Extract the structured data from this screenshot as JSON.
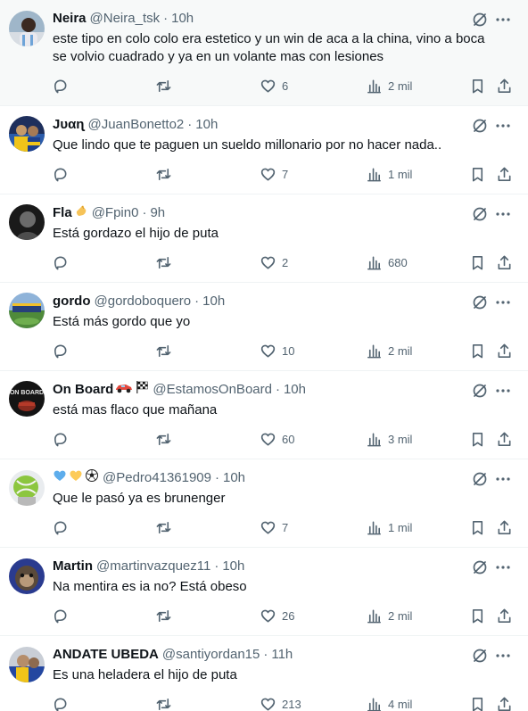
{
  "colors": {
    "text": "#0f1419",
    "secondary": "#536471",
    "border": "#eff3f4",
    "highlight": "#f7f9f9"
  },
  "tweets": [
    {
      "name": "Neira",
      "handle": "@Neira_tsk",
      "sep": "·",
      "time": "10h",
      "text": "este tipo en colo colo era estetico y un win de aca a la china, vino a boca se volvio cuadrado y ya en un volante mas con lesiones",
      "likes": "6",
      "views": "2 mil",
      "avatar": "neira",
      "badges": []
    },
    {
      "name": "Jυαɳ",
      "handle": "@JuanBonetto2",
      "sep": "·",
      "time": "10h",
      "text": "Que lindo que te paguen un sueldo millonario por no hacer nada..",
      "likes": "7",
      "views": "1 mil",
      "avatar": "juan",
      "badges": []
    },
    {
      "name": "Fla",
      "handle": "@Fpin0",
      "sep": "·",
      "time": "9h",
      "text": "Está gordazo el hijo de puta",
      "likes": "2",
      "views": "680",
      "avatar": "fla",
      "badges": [
        "fingers-crossed-emoji"
      ]
    },
    {
      "name": "gordo",
      "handle": "@gordoboquero",
      "sep": "·",
      "time": "10h",
      "text": "Está más gordo que yo",
      "likes": "10",
      "views": "2 mil",
      "avatar": "gordo",
      "badges": []
    },
    {
      "name": "On Board",
      "handle": "@EstamosOnBoard",
      "sep": "·",
      "time": "10h",
      "text": "está mas flaco que mañana",
      "likes": "60",
      "views": "3 mil",
      "avatar": "onboard",
      "avatar_text": "ON BOARD",
      "badges": [
        "race-car-emoji",
        "checkered-flag-emoji"
      ]
    },
    {
      "name": "",
      "handle": "@Pedro41361909",
      "sep": "·",
      "time": "10h",
      "text": "Que le pasó ya es brunenger",
      "likes": "7",
      "views": "1 mil",
      "avatar": "pedro",
      "badges": [
        "blue-heart-emoji",
        "yellow-heart-emoji",
        "soccer-ball-emoji"
      ]
    },
    {
      "name": "Martin",
      "handle": "@martinvazquez11",
      "sep": "·",
      "time": "10h",
      "text": "Na mentira es ia no? Está obeso",
      "likes": "26",
      "views": "2 mil",
      "avatar": "martin",
      "badges": []
    },
    {
      "name": "ANDATE UBEDA",
      "handle": "@santiyordan15",
      "sep": "·",
      "time": "11h",
      "text": "Es una heladera el hijo de puta",
      "likes": "213",
      "views": "4 mil",
      "avatar": "andate",
      "badges": []
    }
  ]
}
